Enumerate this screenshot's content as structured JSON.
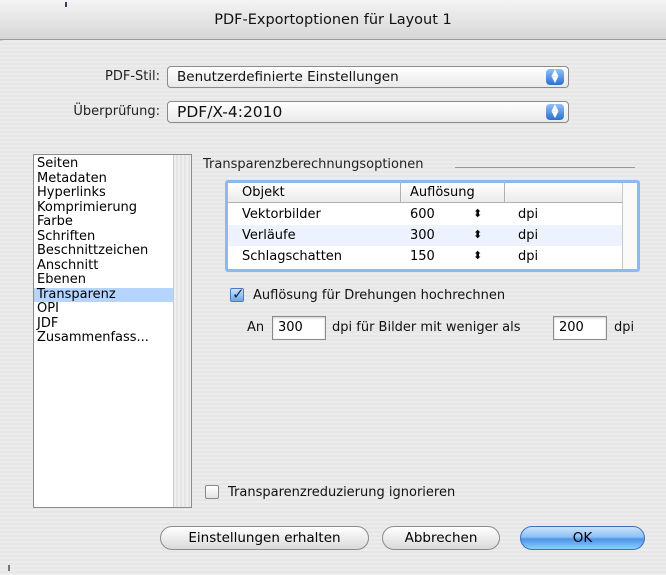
{
  "window": {
    "title": "PDF-Exportoptionen für Layout 1"
  },
  "pdf_style": {
    "label": "PDF-Stil:",
    "value": "Benutzerdefinierte Einstellungen"
  },
  "verification": {
    "label": "Überprüfung:",
    "value": "PDF/X-4:2010"
  },
  "sidebar": {
    "items": [
      {
        "label": "Seiten"
      },
      {
        "label": "Metadaten"
      },
      {
        "label": "Hyperlinks"
      },
      {
        "label": "Komprimierung"
      },
      {
        "label": "Farbe"
      },
      {
        "label": "Schriften"
      },
      {
        "label": "Beschnittzeichen"
      },
      {
        "label": "Anschnitt"
      },
      {
        "label": "Ebenen"
      },
      {
        "label": "Transparenz"
      },
      {
        "label": "OPI"
      },
      {
        "label": "JDF"
      },
      {
        "label": "Zusammenfass..."
      }
    ],
    "selected": "Transparenz"
  },
  "transparency": {
    "section_title": "Transparenzberechnungsoptionen",
    "table": {
      "headers": {
        "object": "Objekt",
        "resolution": "Auflösung"
      },
      "rows": [
        {
          "object": "Vektorbilder",
          "resolution": "600",
          "stepper": "⬍",
          "unit": "dpi"
        },
        {
          "object": "Verläufe",
          "resolution": "300",
          "stepper": "⬍",
          "unit": "dpi"
        },
        {
          "object": "Schlagschatten",
          "resolution": "150",
          "stepper": "⬍",
          "unit": "dpi"
        }
      ]
    },
    "upsample_checkbox": {
      "label": "Auflösung für Drehungen hochrechnen",
      "checked": true
    },
    "an_line": {
      "prefix": "An",
      "dpi_value": "300",
      "middle": "dpi für Bilder mit weniger als",
      "threshold_value": "200",
      "suffix": "dpi"
    },
    "ignore_checkbox": {
      "label": "Transparenzreduzierung ignorieren",
      "checked": false
    }
  },
  "buttons": {
    "keep_settings": "Einstellungen erhalten",
    "cancel": "Abbrechen",
    "ok": "OK"
  },
  "colors": {
    "selection": "#b5d5ff",
    "accent": "#4d94e8",
    "table_focus": "#8db8f1"
  }
}
